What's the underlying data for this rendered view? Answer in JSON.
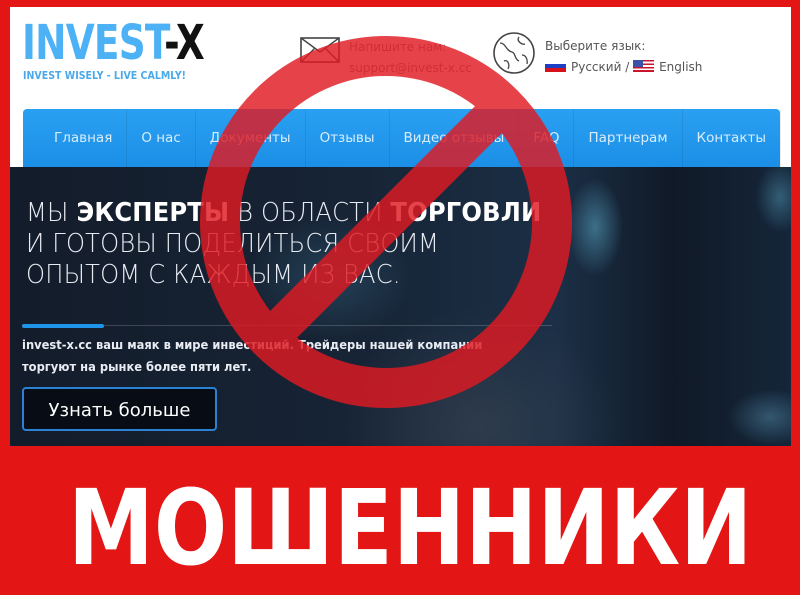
{
  "header": {
    "logo_part1": "INVEST",
    "logo_part2": "-X",
    "tagline": "INVEST WISELY - LIVE CALMLY!",
    "contact_label": "Напишите нам:",
    "contact_email": "support@invest-x.cc",
    "language_label": "Выберите язык:",
    "language_ru": "Русский",
    "language_separator": " / ",
    "language_en": "English"
  },
  "nav": {
    "items": [
      {
        "label": "Главная",
        "active": true
      },
      {
        "label": "О нас"
      },
      {
        "label": "Документы"
      },
      {
        "label": "Отзывы"
      },
      {
        "label": "Видео отзывы"
      },
      {
        "label": "FAQ"
      },
      {
        "label": "Партнерам"
      },
      {
        "label": "Контакты"
      }
    ]
  },
  "hero": {
    "title_parts": [
      "МЫ ",
      "ЭКСПЕРТЫ",
      " В ОБЛАСТИ ",
      "ТОРГОВЛИ",
      " И ГОТОВЫ ПОДЕЛИТЬСЯ СВОИМ ОПЫТОМ С КАЖДЫМ ИЗ ВАС."
    ],
    "description": "invest-x.cc ваш маяк в мире инвестиций. Трейдеры нашей компании торгуют на рынке более пяти лет.",
    "button_label": "Узнать больше"
  },
  "overlay": {
    "sign": "prohibition-sign",
    "banner_text": "МОШЕННИКИ"
  },
  "colors": {
    "frame_red": "#e31515",
    "sign_red": "#dc1c24",
    "nav_blue": "#2196ee",
    "logo_blue": "#4db1f5"
  }
}
